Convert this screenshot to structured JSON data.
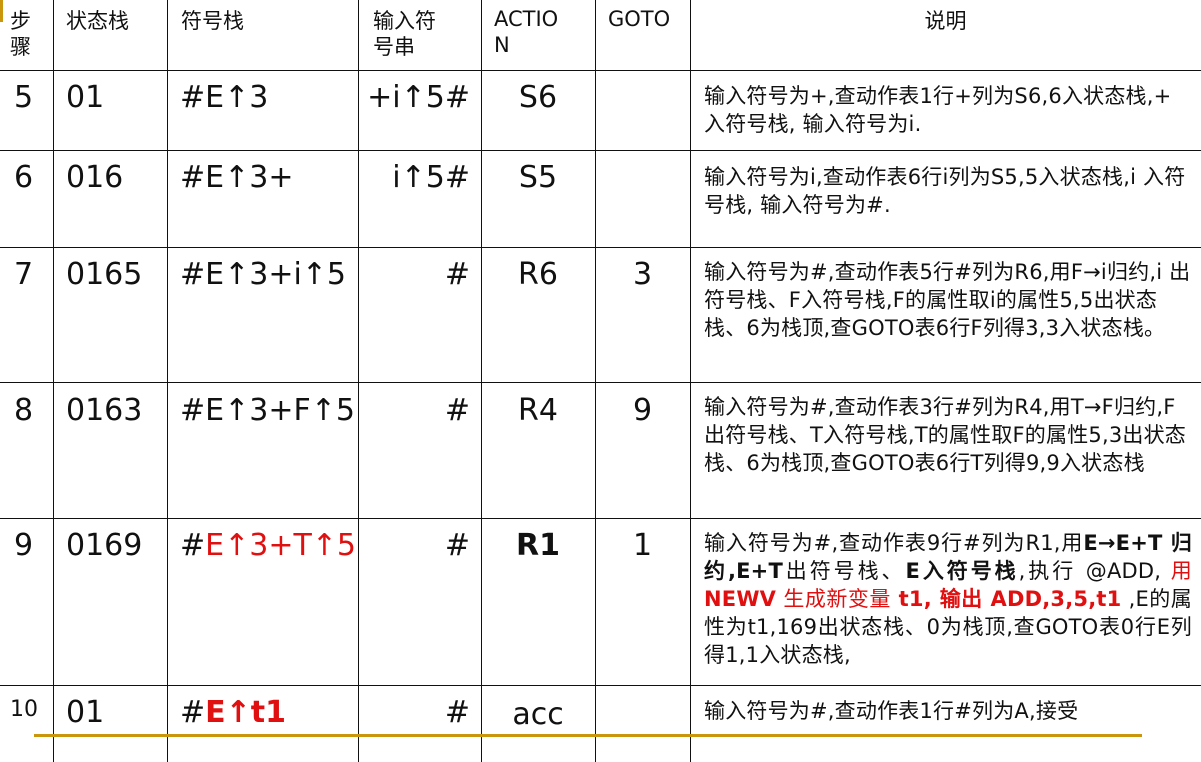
{
  "headers": {
    "step": "步\n骤",
    "state_stack": "状态栈",
    "symbol_stack": "符号栈",
    "input": "输入符\n号串",
    "action": "ACTIO\nN",
    "goto": "GOTO",
    "desc": "说明"
  },
  "rows": [
    {
      "step": "5",
      "state": "01",
      "symbol": "#E↑3",
      "input": "+i↑5#",
      "action": "S6",
      "goto": "",
      "desc": [
        {
          "t": "输入符号为+,查动作表1行+列为S6,6入状态栈,+ 入符号栈, 输入符号为i."
        }
      ]
    },
    {
      "step": "6",
      "state": "016",
      "symbol": "#E↑3+",
      "input": "i↑5#",
      "action": "S5",
      "goto": "",
      "desc": [
        {
          "t": "输入符号为i,查动作表6行i列为S5,5入状态栈,i 入符号栈, 输入符号为#."
        }
      ]
    },
    {
      "step": "7",
      "state": "0165",
      "symbol": "#E↑3+i↑5",
      "input": "#",
      "action": "R6",
      "goto": "3",
      "desc": [
        {
          "t": "输入符号为#,查动作表5行#列为R6,用F→i归约,i  出符号栈、F入符号栈,F的属性取i的属性5,5出状态栈、6为栈顶,查GOTO表6行F列得3,3入状态栈。"
        }
      ]
    },
    {
      "step": "8",
      "state": "0163",
      "symbol": "#E↑3+F↑5",
      "input": "#",
      "action": "R4",
      "goto": "9",
      "desc": [
        {
          "t": "输入符号为#,查动作表3行#列为R4,用T→F归约,F  出符号栈、T入符号栈,T的属性取F的属性5,3出状态栈、6为栈顶,查GOTO表6行T列得9,9入状态栈"
        }
      ]
    },
    {
      "step": "9",
      "state": "0169",
      "symbol_prefix": "#",
      "symbol_red": "E↑3+T↑5",
      "input": "#",
      "action": "R1",
      "goto": "1",
      "desc": [
        {
          "t": "输入符号为#,查动作表9行#列为R1,用"
        },
        {
          "t": "E→E+T 归约,E+T",
          "b": true
        },
        {
          "t": "出符号栈、"
        },
        {
          "t": "E",
          "b": true
        },
        {
          "t": "入符号栈",
          "b": true
        },
        {
          "t": ",执行 @ADD, "
        },
        {
          "t": "用 ",
          "red": true
        },
        {
          "t": "NEWV",
          "red": true,
          "b": true
        },
        {
          "t": " 生成新变量",
          "red": true
        },
        {
          "t": " t1, 输出 ADD,3,5,t1",
          "red": true,
          "b": true
        },
        {
          "t": "  ,E的属性为t1,169出状态栈、0为栈顶,查GOTO表0行E列得1,1入状态栈,"
        }
      ]
    },
    {
      "step": "10",
      "state": "01",
      "symbol_prefix": "#",
      "symbol_red": "E↑t1",
      "input": "#",
      "action": "acc",
      "goto": "",
      "desc": [
        {
          "t": "输入符号为#,查动作表1行#列为A,接受"
        }
      ]
    }
  ],
  "colors": {
    "red": "#e01010",
    "accent_line": "#c9960c",
    "grid": "#111111"
  }
}
